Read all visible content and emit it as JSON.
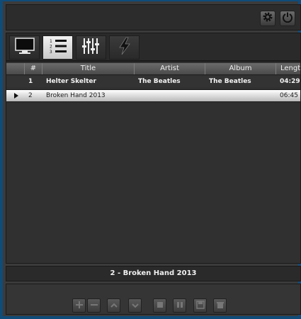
{
  "toolbar": {
    "settings_icon": "gear-icon",
    "power_icon": "power-icon"
  },
  "tabs": [
    {
      "name": "monitor",
      "icon": "monitor-icon",
      "active": false
    },
    {
      "name": "playlist",
      "icon": "numbered-list-icon",
      "active": true
    },
    {
      "name": "equalizer",
      "icon": "equalizer-sliders-icon",
      "active": false
    },
    {
      "name": "power",
      "icon": "lightning-icon",
      "active": false
    }
  ],
  "playlist": {
    "columns": [
      "#",
      "Title",
      "Artist",
      "Album",
      "Length"
    ],
    "rows": [
      {
        "num": "1",
        "title": "Helter Skelter",
        "artist": "The Beatles",
        "album": "The Beatles",
        "length": "04:29",
        "playing": false
      },
      {
        "num": "2",
        "title": "Broken Hand 2013",
        "artist": "",
        "album": "",
        "length": "06:45",
        "playing": true
      }
    ]
  },
  "now_playing": "2 - Broken Hand 2013",
  "controls": [
    {
      "name": "add-button",
      "icon": "plus-icon"
    },
    {
      "name": "remove-button",
      "icon": "minus-icon"
    },
    {
      "name": "move-up-button",
      "icon": "chevron-up-icon"
    },
    {
      "name": "move-down-button",
      "icon": "chevron-down-icon"
    },
    {
      "name": "stop-button",
      "icon": "stop-icon"
    },
    {
      "name": "pause-button",
      "icon": "pause-icon"
    },
    {
      "name": "save-button",
      "icon": "save-icon"
    },
    {
      "name": "clear-button",
      "icon": "trash-icon"
    }
  ],
  "colors": {
    "window_border": "#0f4c7a",
    "background": "#3b3b3b",
    "selected_row": "#d8d8d8"
  }
}
